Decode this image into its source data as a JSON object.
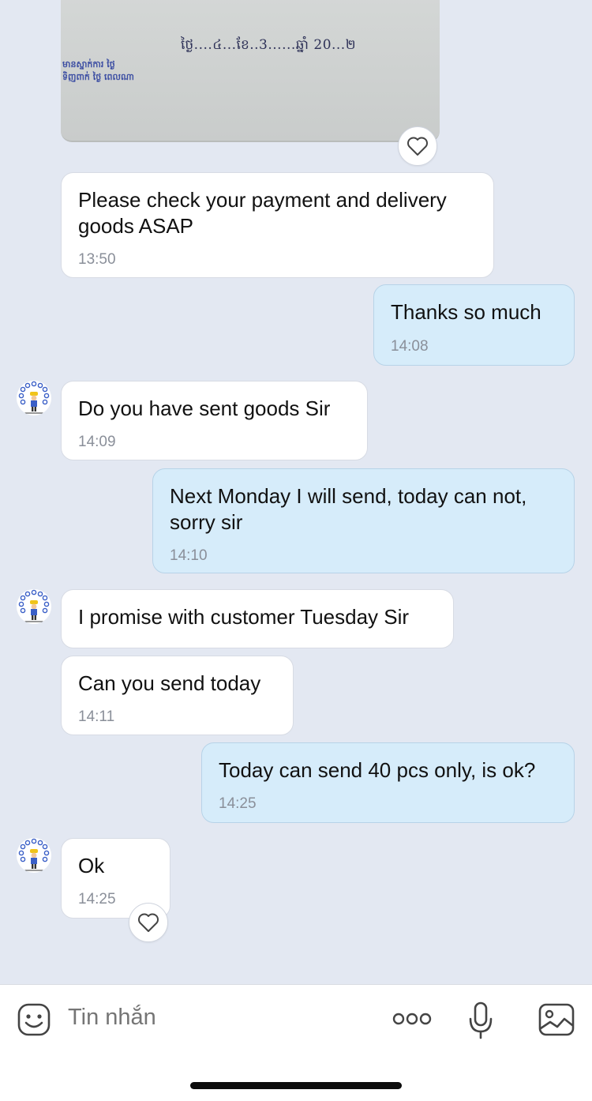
{
  "image_message": {
    "date_text": "ថ្ងៃ....៤...ខែ..3......ឆ្នាំ 20...២",
    "stamp_line1": "មានស្នាក់ការ ថ្ងៃ",
    "stamp_line2": "ទិញពាក់ ថ្ងៃ ពេលណា"
  },
  "messages": [
    {
      "direction": "in",
      "text": "Please check your payment and delivery goods ASAP",
      "time": "13:50"
    },
    {
      "direction": "out",
      "text": "Thanks so much",
      "time": "14:08"
    },
    {
      "direction": "in",
      "text": "Do you have sent goods Sir",
      "time": "14:09"
    },
    {
      "direction": "out",
      "text": "Next Monday I will send, today can not, sorry sir",
      "time": "14:10"
    },
    {
      "direction": "in",
      "text": "I promise with customer Tuesday Sir",
      "time": ""
    },
    {
      "direction": "in",
      "text": "Can you send today",
      "time": "14:11"
    },
    {
      "direction": "out",
      "text": "Today can send 40 pcs only, is ok?",
      "time": "14:25"
    },
    {
      "direction": "in",
      "text": "Ok",
      "time": "14:25"
    }
  ],
  "input": {
    "placeholder": "Tin nhắn"
  },
  "icons": {
    "emoji": "emoji-icon",
    "more": "more-icon",
    "mic": "microphone-icon",
    "image": "image-icon",
    "like": "heart-icon"
  },
  "colors": {
    "background": "#e3e8f2",
    "incoming_bubble": "#ffffff",
    "outgoing_bubble": "#d6ecfa",
    "timestamp": "#8a8f99"
  }
}
